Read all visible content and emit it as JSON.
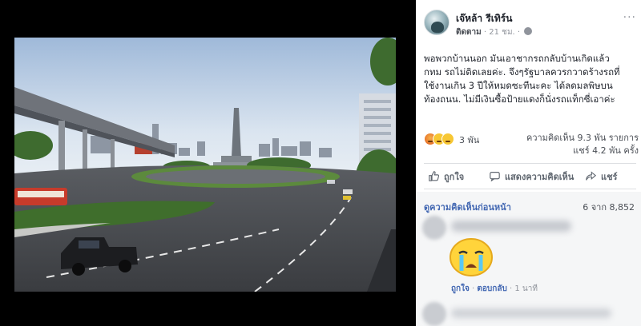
{
  "post": {
    "author": "เจ๊หล้า รีเทิร์น",
    "follow": "ติดตาม",
    "time": "21 ชม.",
    "more": "···",
    "text_lines": [
      "พอพวกบ้านนอก มันเอาชากรถกลับบ้านเกิดแล้ว",
      "กทม รถไม่ติดเลยค่ะ. จึงๆรัฐบาลควรกวาดร้างรถที่",
      "ใช้งานเกิน 3 ปีให้หมดซะทีนะคะ ได้ลดมลพิษบน",
      "ท้องถนน. ไม่มีเงินซื้อป้ายแดงก็นั่งรถแท็กซี่เอาค่ะ"
    ]
  },
  "stats": {
    "reactions": "3 พัน",
    "comments": "ความคิดเห็น 9.3 พัน รายการ",
    "shares": "แชร์ 4.2 พัน ครั้ง"
  },
  "actions": {
    "like": "ถูกใจ",
    "comment": "แสดงความคิดเห็น",
    "share": "แชร์"
  },
  "comments": {
    "view_previous": "ดูความคิดเห็นก่อนหน้า",
    "count": "6 จาก 8,852",
    "like": "ถูกใจ",
    "sep": "·",
    "reply": "ตอบกลับ",
    "time": "1 นาที"
  }
}
